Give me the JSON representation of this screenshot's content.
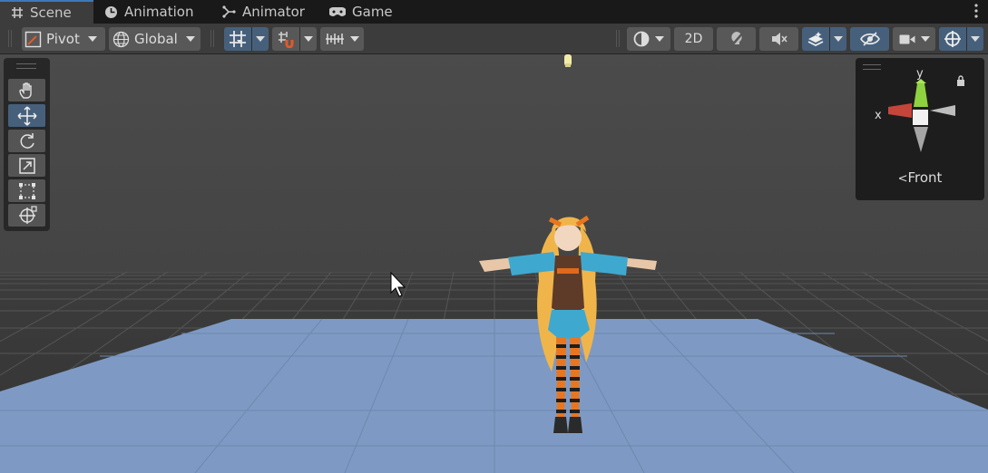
{
  "tabs": [
    {
      "label": "Scene",
      "icon": "grid-icon",
      "active": true
    },
    {
      "label": "Animation",
      "icon": "clock-icon",
      "active": false
    },
    {
      "label": "Animator",
      "icon": "animator-icon",
      "active": false
    },
    {
      "label": "Game",
      "icon": "gamepad-icon",
      "active": false
    }
  ],
  "toolbar": {
    "pivot_label": "Pivot",
    "global_label": "Global",
    "mode_2d_label": "2D"
  },
  "tools": [
    "hand-tool",
    "move-tool",
    "rotate-tool",
    "scale-tool",
    "rect-tool",
    "transform-tool"
  ],
  "active_tool": "move-tool",
  "gizmo": {
    "y_label": "y",
    "x_label": "x",
    "view_label": "Front"
  },
  "colors": {
    "accent": "#46607c",
    "tab_highlight": "#3a79bb",
    "ground_plane": "#7e9ac4",
    "x_axis": "#c4453a",
    "y_axis": "#8ed23f"
  }
}
